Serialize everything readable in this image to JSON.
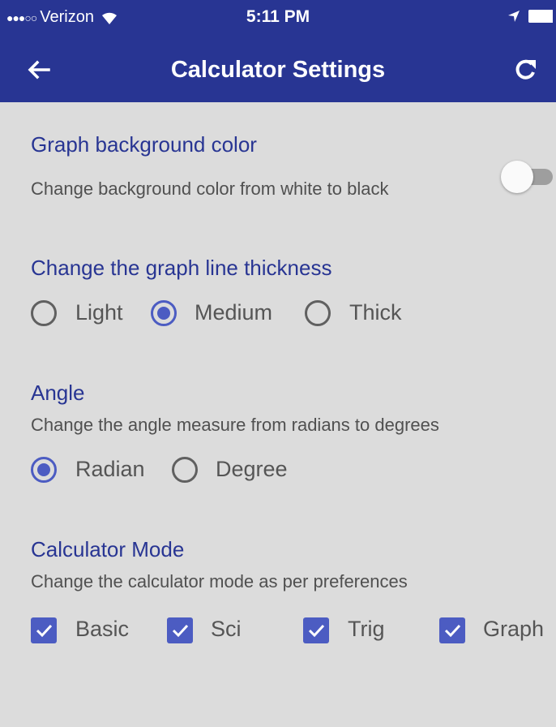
{
  "status_bar": {
    "signal_dots": "●●●○○",
    "carrier": "Verizon",
    "time": "5:11 PM",
    "icons": [
      "wifi-icon",
      "location-arrow-icon",
      "battery-icon"
    ]
  },
  "app_bar": {
    "title": "Calculator Settings",
    "back_icon": "arrow-left-icon",
    "refresh_icon": "refresh-icon",
    "color": "#283593"
  },
  "graph_background": {
    "heading": "Graph background color",
    "description": "Change background color from white to black",
    "toggle_on": false
  },
  "line_thickness": {
    "heading": "Change the graph line thickness",
    "options": [
      {
        "label": "Light",
        "selected": false
      },
      {
        "label": "Medium",
        "selected": true
      },
      {
        "label": "Thick",
        "selected": false
      }
    ]
  },
  "angle": {
    "heading": "Angle",
    "description": "Change the angle measure from radians to degrees",
    "options": [
      {
        "label": "Radian",
        "selected": true
      },
      {
        "label": "Degree",
        "selected": false
      }
    ]
  },
  "calculator_mode": {
    "heading": "Calculator Mode",
    "description": "Change the calculator mode as per preferences",
    "options": [
      {
        "label": "Basic",
        "checked": true
      },
      {
        "label": "Sci",
        "checked": true
      },
      {
        "label": "Trig",
        "checked": true
      },
      {
        "label": "Graph",
        "checked": true
      }
    ]
  },
  "colors": {
    "accent": "#4c5cc2",
    "heading_text": "#283593",
    "background": "#dcdcdc"
  }
}
